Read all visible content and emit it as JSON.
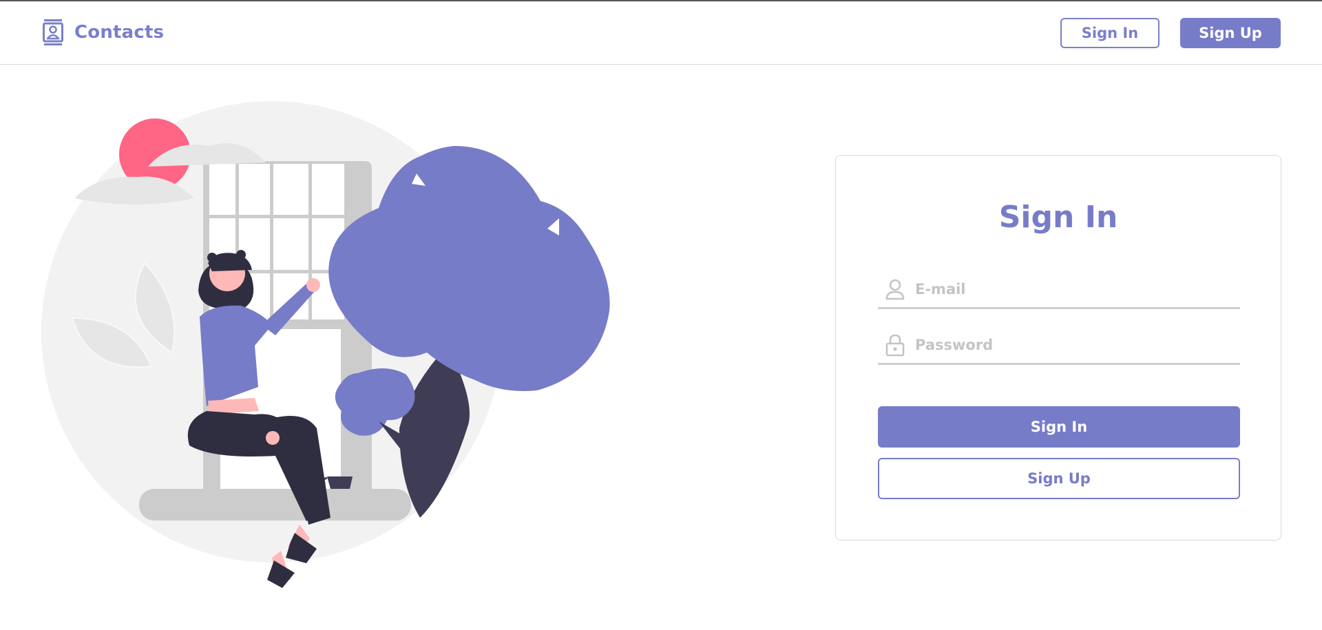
{
  "header": {
    "brand_label": "Contacts",
    "brand_icon": "contact-book-icon",
    "signin_label": "Sign In",
    "signup_label": "Sign Up"
  },
  "form": {
    "title": "Sign In",
    "email_placeholder": "E-mail",
    "email_value": "",
    "email_icon": "user-icon",
    "password_placeholder": "Password",
    "password_value": "",
    "password_icon": "lock-icon",
    "submit_label": "Sign In",
    "signup_label": "Sign Up"
  },
  "colors": {
    "accent": "#777cc8",
    "accent_text": "#7a7fcb",
    "sun": "#ff6584",
    "dark": "#3f3d56",
    "skin": "#ffb8b8",
    "background_circle": "#f2f2f2",
    "window_gray": "#cccccc"
  }
}
